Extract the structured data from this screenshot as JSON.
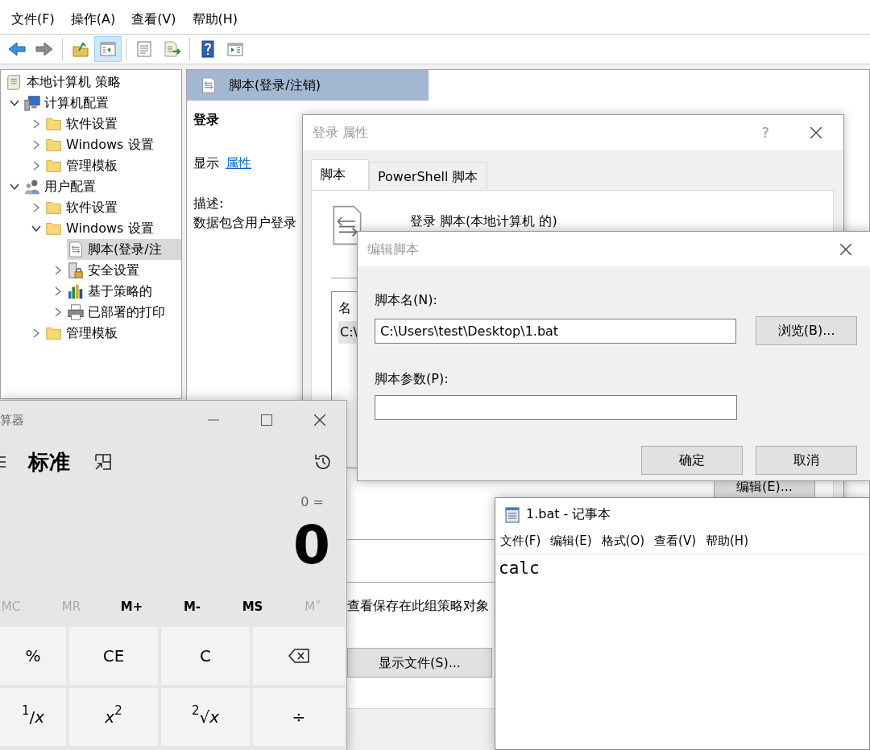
{
  "menu_bar": [
    "文件(F)",
    "操作(A)",
    "查看(V)",
    "帮助(H)"
  ],
  "toolbar": [
    {
      "kind": "back",
      "selected": false
    },
    {
      "kind": "forward",
      "selected": false
    },
    {
      "kind": "up",
      "selected": false
    },
    {
      "kind": "tree",
      "selected": true
    },
    {
      "kind": "properties",
      "selected": false
    },
    {
      "kind": "export",
      "selected": false
    },
    {
      "kind": "help",
      "selected": false
    },
    {
      "kind": "view",
      "selected": false
    }
  ],
  "tree": [
    {
      "label": "本地计算机 策略",
      "kind": "policy",
      "selected": false,
      "children": [
        {
          "label": "计算机配置",
          "kind": "computer",
          "expanded": true,
          "selected": false,
          "children": [
            {
              "label": "软件设置",
              "kind": "folder",
              "expanded": false,
              "selected": false
            },
            {
              "label": "Windows 设置",
              "kind": "folder",
              "expanded": false,
              "selected": false
            },
            {
              "label": "管理模板",
              "kind": "folder",
              "expanded": false,
              "selected": false
            }
          ]
        },
        {
          "label": "用户配置",
          "kind": "users",
          "expanded": true,
          "selected": false,
          "children": [
            {
              "label": "软件设置",
              "kind": "folder",
              "expanded": false,
              "selected": false
            },
            {
              "label": "Windows 设置",
              "kind": "folder",
              "expanded": true,
              "selected": false,
              "children": [
                {
                  "label": "脚本(登录/注",
                  "kind": "script",
                  "selected": true
                },
                {
                  "label": "安全设置",
                  "kind": "security",
                  "expanded": false,
                  "selected": false
                },
                {
                  "label": "基于策略的",
                  "kind": "qos",
                  "expanded": false,
                  "selected": false
                },
                {
                  "label": "已部署的打印",
                  "kind": "printer",
                  "expanded": false,
                  "selected": false
                }
              ]
            },
            {
              "label": "管理模板",
              "kind": "folder",
              "expanded": false,
              "selected": false
            }
          ]
        }
      ]
    }
  ],
  "details_pane": {
    "title": "脚本(登录/注销)",
    "heading": "登录",
    "show_label": "显示",
    "show_link": "属性",
    "description_label": "描述:",
    "description": "数据包含用户登录"
  },
  "properties_dialog": {
    "title": "登录 属性",
    "help": "?",
    "tabs": [
      {
        "label": "脚本",
        "selected": true
      },
      {
        "label": "PowerShell 脚本",
        "selected": false
      }
    ],
    "heading": "登录 脚本(本地计算机 的)",
    "list_column": "名",
    "list_rows": [
      {
        "text": "C:\\",
        "selected": true
      }
    ],
    "edit_button": "编辑(E)...",
    "note": "查看保存在此组策略对象",
    "show_files_button": "显示文件(S)..."
  },
  "edit_dialog": {
    "title": "编辑脚本",
    "name_label": "脚本名(N):",
    "name_value": "C:\\Users\\test\\Desktop\\1.bat",
    "browse_button": "浏览(B)...",
    "params_label": "脚本参数(P):",
    "buttons": [
      "确定",
      "取消"
    ]
  },
  "calculator": {
    "title": "算器",
    "mode": "标准",
    "expression": "0 =",
    "display": "0",
    "memory": [
      {
        "label": "MC",
        "disabled": true
      },
      {
        "label": "MR",
        "disabled": true
      },
      {
        "label": "M+",
        "disabled": false
      },
      {
        "label": "M-",
        "disabled": false
      },
      {
        "label": "MS",
        "disabled": false
      },
      {
        "label": "M˅",
        "disabled": true
      }
    ],
    "keys": [
      {
        "kind": "text",
        "label": "%"
      },
      {
        "kind": "text",
        "label": "CE"
      },
      {
        "kind": "text",
        "label": "C"
      },
      {
        "kind": "backspace"
      },
      {
        "kind": "text",
        "label": "$^{1}$/*x*"
      },
      {
        "kind": "text",
        "label": "*x*$^{2}$"
      },
      {
        "kind": "text",
        "label": "$^{2}$√*x*"
      },
      {
        "kind": "text",
        "label": "÷"
      }
    ]
  },
  "notepad": {
    "title": "1.bat - 记事本",
    "menu": [
      "文件(F)",
      "编辑(E)",
      "格式(O)",
      "查看(V)",
      "帮助(H)"
    ],
    "content": "calc"
  }
}
